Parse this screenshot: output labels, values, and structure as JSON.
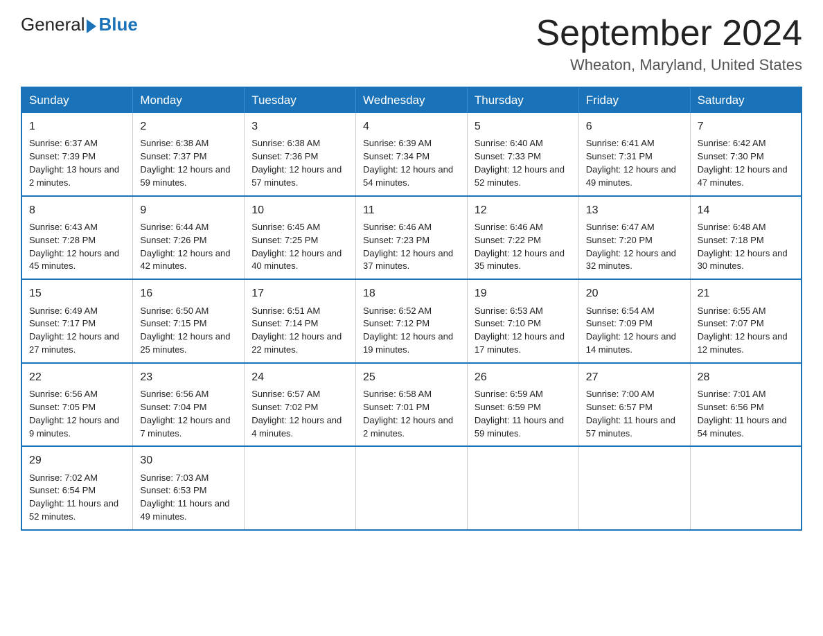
{
  "logo": {
    "text_general": "General",
    "text_blue": "Blue"
  },
  "title": "September 2024",
  "subtitle": "Wheaton, Maryland, United States",
  "days": [
    "Sunday",
    "Monday",
    "Tuesday",
    "Wednesday",
    "Thursday",
    "Friday",
    "Saturday"
  ],
  "weeks": [
    [
      {
        "num": "1",
        "sunrise": "6:37 AM",
        "sunset": "7:39 PM",
        "daylight": "13 hours and 2 minutes."
      },
      {
        "num": "2",
        "sunrise": "6:38 AM",
        "sunset": "7:37 PM",
        "daylight": "12 hours and 59 minutes."
      },
      {
        "num": "3",
        "sunrise": "6:38 AM",
        "sunset": "7:36 PM",
        "daylight": "12 hours and 57 minutes."
      },
      {
        "num": "4",
        "sunrise": "6:39 AM",
        "sunset": "7:34 PM",
        "daylight": "12 hours and 54 minutes."
      },
      {
        "num": "5",
        "sunrise": "6:40 AM",
        "sunset": "7:33 PM",
        "daylight": "12 hours and 52 minutes."
      },
      {
        "num": "6",
        "sunrise": "6:41 AM",
        "sunset": "7:31 PM",
        "daylight": "12 hours and 49 minutes."
      },
      {
        "num": "7",
        "sunrise": "6:42 AM",
        "sunset": "7:30 PM",
        "daylight": "12 hours and 47 minutes."
      }
    ],
    [
      {
        "num": "8",
        "sunrise": "6:43 AM",
        "sunset": "7:28 PM",
        "daylight": "12 hours and 45 minutes."
      },
      {
        "num": "9",
        "sunrise": "6:44 AM",
        "sunset": "7:26 PM",
        "daylight": "12 hours and 42 minutes."
      },
      {
        "num": "10",
        "sunrise": "6:45 AM",
        "sunset": "7:25 PM",
        "daylight": "12 hours and 40 minutes."
      },
      {
        "num": "11",
        "sunrise": "6:46 AM",
        "sunset": "7:23 PM",
        "daylight": "12 hours and 37 minutes."
      },
      {
        "num": "12",
        "sunrise": "6:46 AM",
        "sunset": "7:22 PM",
        "daylight": "12 hours and 35 minutes."
      },
      {
        "num": "13",
        "sunrise": "6:47 AM",
        "sunset": "7:20 PM",
        "daylight": "12 hours and 32 minutes."
      },
      {
        "num": "14",
        "sunrise": "6:48 AM",
        "sunset": "7:18 PM",
        "daylight": "12 hours and 30 minutes."
      }
    ],
    [
      {
        "num": "15",
        "sunrise": "6:49 AM",
        "sunset": "7:17 PM",
        "daylight": "12 hours and 27 minutes."
      },
      {
        "num": "16",
        "sunrise": "6:50 AM",
        "sunset": "7:15 PM",
        "daylight": "12 hours and 25 minutes."
      },
      {
        "num": "17",
        "sunrise": "6:51 AM",
        "sunset": "7:14 PM",
        "daylight": "12 hours and 22 minutes."
      },
      {
        "num": "18",
        "sunrise": "6:52 AM",
        "sunset": "7:12 PM",
        "daylight": "12 hours and 19 minutes."
      },
      {
        "num": "19",
        "sunrise": "6:53 AM",
        "sunset": "7:10 PM",
        "daylight": "12 hours and 17 minutes."
      },
      {
        "num": "20",
        "sunrise": "6:54 AM",
        "sunset": "7:09 PM",
        "daylight": "12 hours and 14 minutes."
      },
      {
        "num": "21",
        "sunrise": "6:55 AM",
        "sunset": "7:07 PM",
        "daylight": "12 hours and 12 minutes."
      }
    ],
    [
      {
        "num": "22",
        "sunrise": "6:56 AM",
        "sunset": "7:05 PM",
        "daylight": "12 hours and 9 minutes."
      },
      {
        "num": "23",
        "sunrise": "6:56 AM",
        "sunset": "7:04 PM",
        "daylight": "12 hours and 7 minutes."
      },
      {
        "num": "24",
        "sunrise": "6:57 AM",
        "sunset": "7:02 PM",
        "daylight": "12 hours and 4 minutes."
      },
      {
        "num": "25",
        "sunrise": "6:58 AM",
        "sunset": "7:01 PM",
        "daylight": "12 hours and 2 minutes."
      },
      {
        "num": "26",
        "sunrise": "6:59 AM",
        "sunset": "6:59 PM",
        "daylight": "11 hours and 59 minutes."
      },
      {
        "num": "27",
        "sunrise": "7:00 AM",
        "sunset": "6:57 PM",
        "daylight": "11 hours and 57 minutes."
      },
      {
        "num": "28",
        "sunrise": "7:01 AM",
        "sunset": "6:56 PM",
        "daylight": "11 hours and 54 minutes."
      }
    ],
    [
      {
        "num": "29",
        "sunrise": "7:02 AM",
        "sunset": "6:54 PM",
        "daylight": "11 hours and 52 minutes."
      },
      {
        "num": "30",
        "sunrise": "7:03 AM",
        "sunset": "6:53 PM",
        "daylight": "11 hours and 49 minutes."
      },
      null,
      null,
      null,
      null,
      null
    ]
  ]
}
